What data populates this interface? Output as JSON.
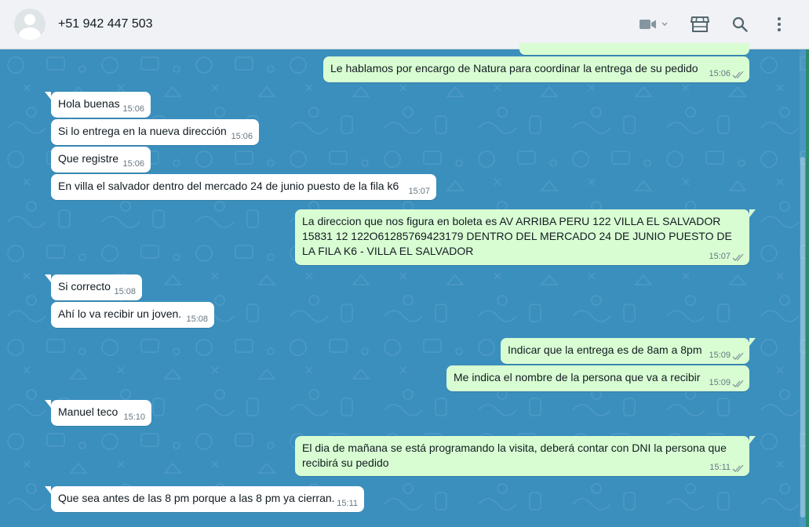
{
  "header": {
    "contact_name": "+51 942 447 503",
    "icons": [
      "default-avatar-icon",
      "video-call-icon",
      "chevron-down-icon",
      "catalog-store-icon",
      "search-icon",
      "menu-dots-icon"
    ]
  },
  "colors": {
    "header_bg": "#f0f2f5",
    "chat_bg": "#3a8fbd",
    "incoming_bubble": "#ffffff",
    "outgoing_bubble": "#d9fdd3",
    "read_ticks": "#8696a0",
    "accent": "#2e8b6a"
  },
  "messages": [
    {
      "dir": "out",
      "text": "Le hablamos por encargo de Natura para coordinar la entrega de su pedido",
      "time": "15:06"
    },
    {
      "dir": "in",
      "text": "Hola buenas",
      "time": "15:06"
    },
    {
      "dir": "in",
      "text": "Si lo entrega en la nueva dirección",
      "time": "15:06"
    },
    {
      "dir": "in",
      "text": "Que registre",
      "time": "15:06"
    },
    {
      "dir": "in",
      "text": "En villa el salvador dentro del mercado 24 de junio puesto  de la fila k6",
      "time": "15:07"
    },
    {
      "dir": "out",
      "text": "La direccion que nos figura en boleta es AV ARRIBA PERU 122 VILLA EL SALVADOR 15831 12 122O61285769423179 DENTRO DEL MERCADO 24 DE JUNIO PUESTO DE LA FILA K6 - VILLA EL SALVADOR",
      "time": "15:07"
    },
    {
      "dir": "in",
      "text": "Si correcto",
      "time": "15:08"
    },
    {
      "dir": "in",
      "text": "Ahí lo va recibir un joven.",
      "time": "15:08"
    },
    {
      "dir": "out",
      "text": "Indicar que la entrega es de 8am a 8pm",
      "time": "15:09"
    },
    {
      "dir": "out",
      "text": "Me indica el nombre de la persona que va a recibir",
      "time": "15:09"
    },
    {
      "dir": "in",
      "text": "Manuel teco",
      "time": "15:10"
    },
    {
      "dir": "out",
      "text": "El dia de mañana se está programando la visita, deberá contar con DNI la persona que recibirá su pedido",
      "time": "15:11"
    },
    {
      "dir": "in",
      "text": "Que sea antes de las 8 pm porque a las 8 pm ya cierran.",
      "time": "15:11"
    }
  ]
}
